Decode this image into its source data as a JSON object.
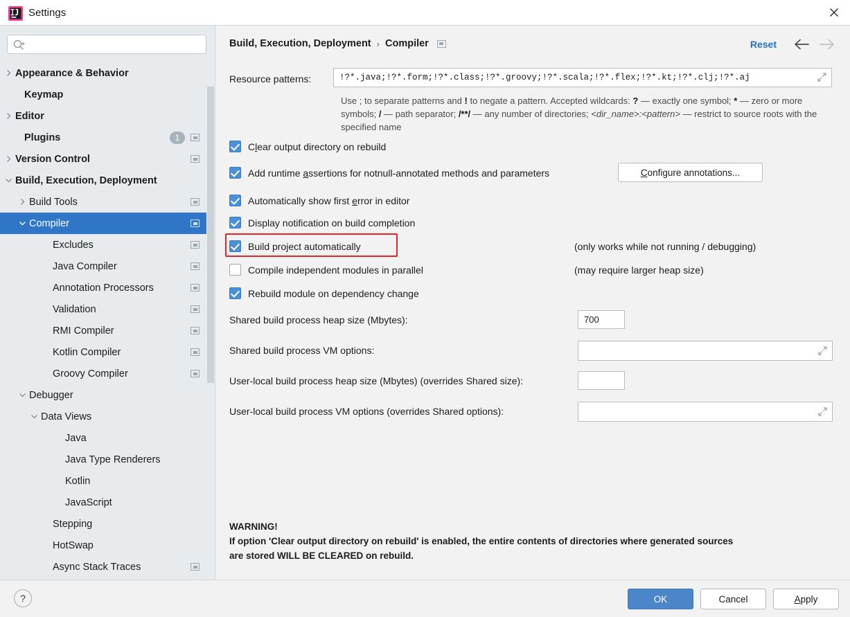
{
  "window": {
    "title": "Settings",
    "logo_icon": "intellij-idea-logo",
    "close_icon": "close-icon"
  },
  "sidebar": {
    "search": {
      "placeholder": "",
      "value": "",
      "icon": "search-icon"
    },
    "items": [
      {
        "label": "Appearance & Behavior",
        "indent": 22,
        "twisty": "chevron-right",
        "bold": true,
        "icon": false,
        "badge": null,
        "selected": false
      },
      {
        "label": "Keymap",
        "indent": 35,
        "twisty": "none",
        "bold": true,
        "icon": false,
        "badge": null,
        "selected": false
      },
      {
        "label": "Editor",
        "indent": 22,
        "twisty": "chevron-right",
        "bold": true,
        "icon": false,
        "badge": null,
        "selected": false
      },
      {
        "label": "Plugins",
        "indent": 35,
        "twisty": "none",
        "bold": true,
        "icon": true,
        "badge": "1",
        "selected": false
      },
      {
        "label": "Version Control",
        "indent": 22,
        "twisty": "chevron-right",
        "bold": true,
        "icon": true,
        "badge": null,
        "selected": false
      },
      {
        "label": "Build, Execution, Deployment",
        "indent": 22,
        "twisty": "chevron-down",
        "bold": true,
        "icon": false,
        "badge": null,
        "selected": false
      },
      {
        "label": "Build Tools",
        "indent": 42,
        "twisty": "chevron-right",
        "bold": false,
        "icon": true,
        "badge": null,
        "selected": false
      },
      {
        "label": "Compiler",
        "indent": 42,
        "twisty": "chevron-down",
        "bold": false,
        "icon": true,
        "badge": null,
        "selected": true
      },
      {
        "label": "Excludes",
        "indent": 76,
        "twisty": "none",
        "bold": false,
        "icon": true,
        "badge": null,
        "selected": false
      },
      {
        "label": "Java Compiler",
        "indent": 76,
        "twisty": "none",
        "bold": false,
        "icon": true,
        "badge": null,
        "selected": false
      },
      {
        "label": "Annotation Processors",
        "indent": 76,
        "twisty": "none",
        "bold": false,
        "icon": true,
        "badge": null,
        "selected": false
      },
      {
        "label": "Validation",
        "indent": 76,
        "twisty": "none",
        "bold": false,
        "icon": true,
        "badge": null,
        "selected": false
      },
      {
        "label": "RMI Compiler",
        "indent": 76,
        "twisty": "none",
        "bold": false,
        "icon": true,
        "badge": null,
        "selected": false
      },
      {
        "label": "Kotlin Compiler",
        "indent": 76,
        "twisty": "none",
        "bold": false,
        "icon": true,
        "badge": null,
        "selected": false
      },
      {
        "label": "Groovy Compiler",
        "indent": 76,
        "twisty": "none",
        "bold": false,
        "icon": true,
        "badge": null,
        "selected": false
      },
      {
        "label": "Debugger",
        "indent": 42,
        "twisty": "chevron-down",
        "bold": false,
        "icon": false,
        "badge": null,
        "selected": false
      },
      {
        "label": "Data Views",
        "indent": 59,
        "twisty": "chevron-down",
        "bold": false,
        "icon": false,
        "badge": null,
        "selected": false
      },
      {
        "label": "Java",
        "indent": 94,
        "twisty": "none",
        "bold": false,
        "icon": false,
        "badge": null,
        "selected": false
      },
      {
        "label": "Java Type Renderers",
        "indent": 94,
        "twisty": "none",
        "bold": false,
        "icon": false,
        "badge": null,
        "selected": false
      },
      {
        "label": "Kotlin",
        "indent": 94,
        "twisty": "none",
        "bold": false,
        "icon": false,
        "badge": null,
        "selected": false
      },
      {
        "label": "JavaScript",
        "indent": 94,
        "twisty": "none",
        "bold": false,
        "icon": false,
        "badge": null,
        "selected": false
      },
      {
        "label": "Stepping",
        "indent": 76,
        "twisty": "none",
        "bold": false,
        "icon": false,
        "badge": null,
        "selected": false
      },
      {
        "label": "HotSwap",
        "indent": 76,
        "twisty": "none",
        "bold": false,
        "icon": false,
        "badge": null,
        "selected": false
      },
      {
        "label": "Async Stack Traces",
        "indent": 76,
        "twisty": "none",
        "bold": false,
        "icon": true,
        "badge": null,
        "selected": false
      }
    ]
  },
  "header": {
    "breadcrumb_parent": "Build, Execution, Deployment",
    "breadcrumb_separator": "›",
    "breadcrumb_current": "Compiler",
    "reset_label": "Reset",
    "back_icon": "arrow-left-icon",
    "forward_icon": "arrow-right-icon"
  },
  "main": {
    "resource_patterns": {
      "label": "Resource patterns:",
      "value": "!?*.java;!?*.form;!?*.class;!?*.groovy;!?*.scala;!?*.flex;!?*.kt;!?*.clj;!?*.aj",
      "expand_icon": "expand-icon"
    },
    "hint_line1_a": "Use ; to separate patterns and ",
    "hint_bang": "!",
    "hint_line1_b": " to negate a pattern. Accepted wildcards: ",
    "hint_q": "?",
    "hint_line1_c": " — exactly one symbol; ",
    "hint_star": "*",
    "hint_line1_d": " — zero or more symbols; ",
    "hint_slash": "/",
    "hint_line2_a": " — path separator; ",
    "hint_globstar": "/**/",
    "hint_line2_b": " — any number of directories; ",
    "hint_dirname": "<dir_name>:<pattern>",
    "hint_line2_c": " — restrict to source roots with the specified name",
    "checkboxes": [
      {
        "label_pre": "C",
        "label_mnemonic": "l",
        "label_post": "ear output directory on rebuild",
        "checked": true,
        "note": "",
        "focused": false
      },
      {
        "label_pre": "Add runtime ",
        "label_mnemonic": "a",
        "label_post": "ssertions for notnull-annotated methods and parameters",
        "checked": true,
        "note": "",
        "focused": false
      },
      {
        "label_pre": "Automatically show first ",
        "label_mnemonic": "e",
        "label_post": "rror in editor",
        "checked": true,
        "note": "",
        "focused": false
      },
      {
        "label_pre": "Display notification on build completion",
        "label_mnemonic": "",
        "label_post": "",
        "checked": true,
        "note": "",
        "focused": false
      },
      {
        "label_pre": "Build project automatically",
        "label_mnemonic": "",
        "label_post": "",
        "checked": true,
        "note": "(only works while not running / debugging)",
        "focused": true
      },
      {
        "label_pre": "Compile independent modules in parallel",
        "label_mnemonic": "",
        "label_post": "",
        "checked": false,
        "note": "(may require larger heap size)",
        "focused": false
      },
      {
        "label_pre": "Rebuild module on dependency change",
        "label_mnemonic": "",
        "label_post": "",
        "checked": true,
        "note": "",
        "focused": false
      }
    ],
    "configure_annotations_button": {
      "pre": "C",
      "mnemonic": "C",
      "label": "Configure annotations..."
    },
    "fields": [
      {
        "label": "Shared build process heap size (Mbytes):",
        "value": "700",
        "expandable": false
      },
      {
        "label": "Shared build process VM options:",
        "value": "",
        "expandable": true
      },
      {
        "label": "User-local build process heap size (Mbytes) (overrides Shared size):",
        "value": "",
        "expandable": false
      },
      {
        "label": "User-local build process VM options (overrides Shared options):",
        "value": "",
        "expandable": true
      }
    ],
    "warning_title": "WARNING!",
    "warning_line1": "If option 'Clear output directory on rebuild' is enabled, the entire contents of directories where generated sources",
    "warning_line2": "are stored WILL BE CLEARED on rebuild."
  },
  "footer": {
    "help_label": "?",
    "ok_label": "OK",
    "cancel_label": "Cancel",
    "apply_pre": "A",
    "apply_post": "pply"
  },
  "colors": {
    "accent_blue": "#2f76c7",
    "link_blue": "#2470c4",
    "ok_button": "#4a86c8",
    "checkbox_blue": "#4a90d9",
    "highlight_red": "#e8232a",
    "panel_bg": "#e7ebee",
    "content_bg": "#f2f2f2"
  }
}
